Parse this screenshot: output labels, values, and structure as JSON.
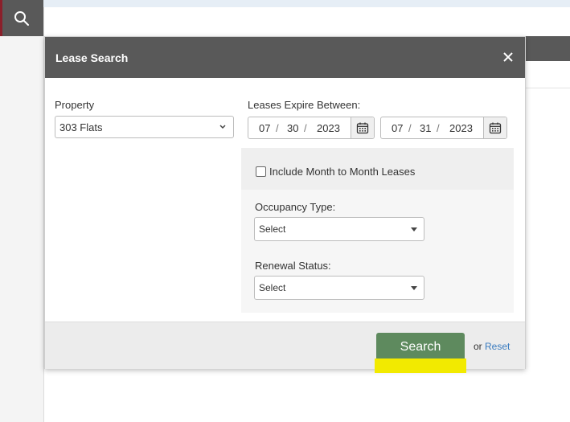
{
  "modal": {
    "title": "Lease Search",
    "close_icon": "close-icon"
  },
  "property": {
    "label": "Property",
    "selected": "303 Flats"
  },
  "lease_expire": {
    "label": "Leases Expire Between:",
    "start": {
      "month": "07",
      "day": "30",
      "year": "2023"
    },
    "end": {
      "month": "07",
      "day": "31",
      "year": "2023"
    },
    "separator": "/"
  },
  "month_to_month": {
    "label": "Include Month to Month Leases",
    "checked": false
  },
  "occupancy": {
    "label": "Occupancy Type:",
    "selected": "Select"
  },
  "renewal": {
    "label": "Renewal Status:",
    "selected": "Select"
  },
  "footer": {
    "search_label": "Search",
    "or_text": "or",
    "reset_label": "Reset"
  },
  "colors": {
    "header_bg": "#595959",
    "search_btn": "#5e8a5e",
    "link": "#3a7bbf",
    "highlight": "#f2ea00",
    "rail_accent": "#8b1f2a"
  }
}
